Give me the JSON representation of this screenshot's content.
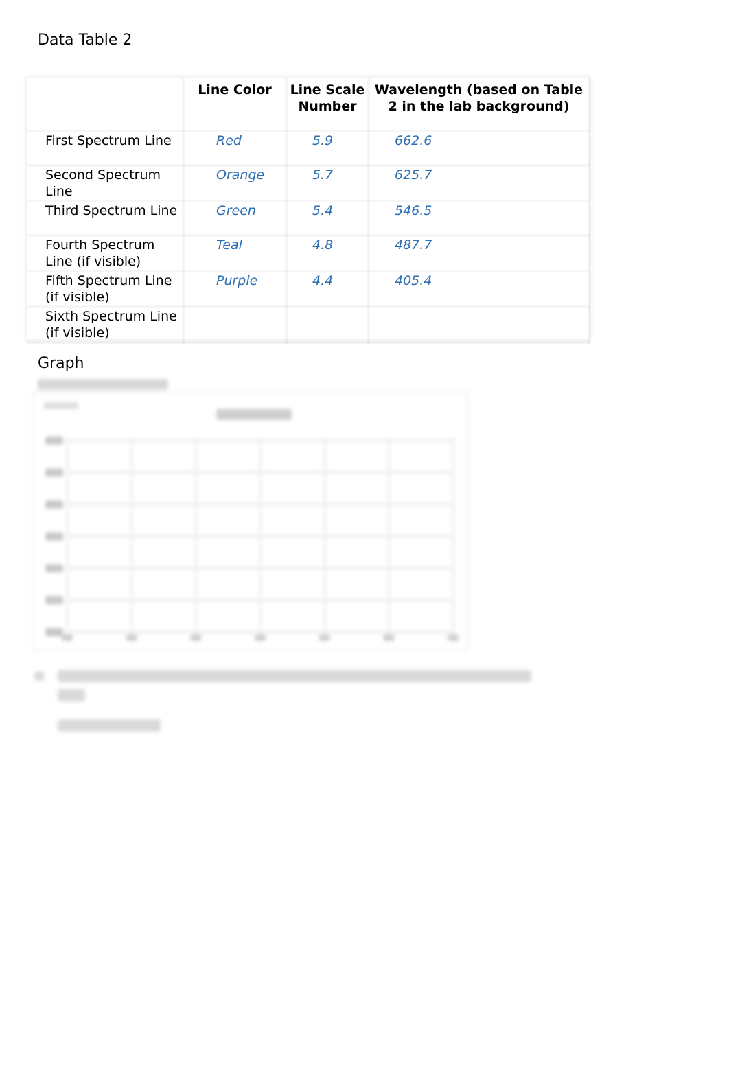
{
  "document": {
    "title": "Data Table 2"
  },
  "table": {
    "headers": [
      "",
      "Line Color",
      "Line Scale Number",
      "Wavelength (based on Table 2 in the lab background)"
    ],
    "rows": [
      {
        "label": "First Spectrum Line",
        "color": "Red",
        "scale": "5.9",
        "wavelength": "662.6"
      },
      {
        "label": "Second Spectrum Line",
        "color": "Orange",
        "scale": "5.7",
        "wavelength": "625.7"
      },
      {
        "label": "Third Spectrum Line",
        "color": "Green",
        "scale": "5.4",
        "wavelength": "546.5"
      },
      {
        "label": "Fourth Spectrum Line (if visible)",
        "color": "Teal",
        "scale": "4.8",
        "wavelength": "487.7"
      },
      {
        "label": "Fifth Spectrum Line (if visible)",
        "color": "Purple",
        "scale": "4.4",
        "wavelength": "405.4"
      },
      {
        "label": "Sixth Spectrum Line (if visible)",
        "color": "",
        "scale": "",
        "wavelength": ""
      }
    ],
    "value_color": "#2e6fb4"
  },
  "graph": {
    "heading": "Graph",
    "content_obscured": true
  },
  "question": {
    "content_obscured": true
  }
}
